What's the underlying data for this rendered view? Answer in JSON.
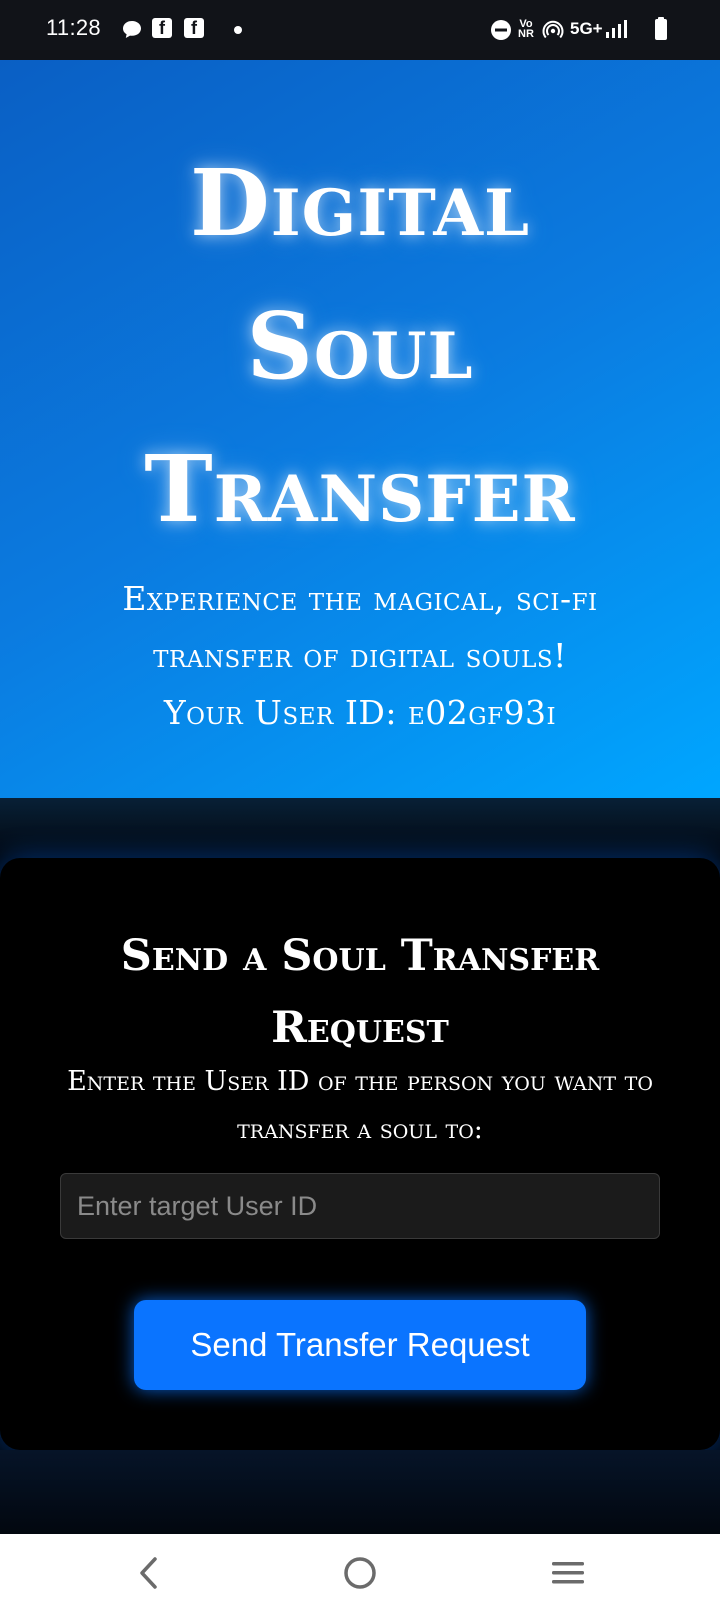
{
  "status_bar": {
    "time": "11:28",
    "network": "5G+",
    "volte": "Vo",
    "volte_sub": "NR",
    "icons": [
      "chat-bubble-icon",
      "facebook-icon",
      "facebook-icon",
      "notification-dot-icon",
      "do-not-disturb-icon",
      "volte-icon",
      "hotspot-icon",
      "signal-icon",
      "battery-icon"
    ]
  },
  "hero": {
    "title_line1": "Digital",
    "title_line2": "Soul",
    "title_line3": "Transfer",
    "subtitle_line1": "Experience the magical, sci-fi",
    "subtitle_line2": "transfer of digital souls!",
    "user_id_line": "Your User ID: e02gf93i"
  },
  "card": {
    "title_line1": "Send a Soul Transfer",
    "title_line2": "Request",
    "description": "Enter the User ID of the person you want to transfer a soul to:",
    "input_placeholder": "Enter target User ID",
    "input_value": "",
    "button_label": "Send Transfer Request"
  },
  "nav_bar": {
    "icons": [
      "back-icon",
      "home-icon",
      "recents-icon"
    ]
  },
  "colors": {
    "accent": "#0a74ff",
    "hero_gradient_start": "#0a5fc4",
    "hero_gradient_end": "#00a6ff",
    "card_background": "#000000"
  }
}
